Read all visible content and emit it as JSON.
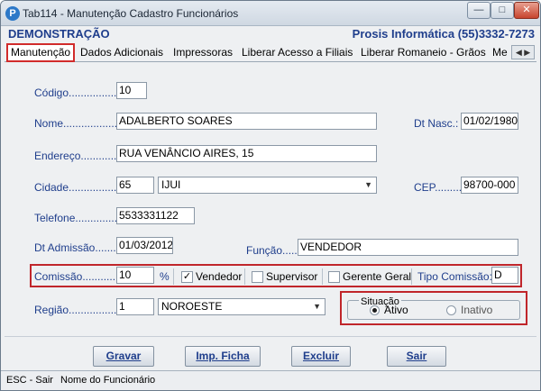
{
  "window": {
    "title": "Tab114 - Manutenção Cadastro Funcionários",
    "app_icon_letter": "P",
    "min_glyph": "—",
    "max_glyph": "□",
    "close_glyph": "✕"
  },
  "header": {
    "company": "DEMONSTRAÇÃO",
    "vendor": "Prosis Informática (55)3332-7273"
  },
  "tabs": [
    {
      "label": "Manutenção",
      "active": true
    },
    {
      "label": "Dados Adicionais"
    },
    {
      "label": "Impressoras"
    },
    {
      "label": "Liberar Acesso a Filiais"
    },
    {
      "label": "Liberar Romaneio - Grãos"
    },
    {
      "label": "Me"
    }
  ],
  "form": {
    "codigo": {
      "label": "Código.................",
      "value": "10"
    },
    "nome": {
      "label": "Nome.........................",
      "value": "ADALBERTO SOARES"
    },
    "dt_nasc": {
      "label": "Dt Nasc.:",
      "value": "01/02/1980"
    },
    "endereco": {
      "label": "Endereço......................",
      "value": "RUA VENÂNCIO AIRES, 15"
    },
    "cidade": {
      "label": "Cidade...........................",
      "code": "65",
      "name": "IJUI"
    },
    "cep": {
      "label": "CEP..........",
      "value": "98700-000"
    },
    "telefone": {
      "label": "Telefone.......................",
      "value": "5533331122"
    },
    "dt_admissao": {
      "label": "Dt Admissão...........",
      "value": "01/03/2012"
    },
    "funcao": {
      "label": "Função.....:",
      "value": "VENDEDOR"
    },
    "comissao": {
      "label": "Comissão...............",
      "value": "10",
      "unit": "%"
    },
    "vendedor": {
      "label": "Vendedor",
      "checked": true
    },
    "supervisor": {
      "label": "Supervisor",
      "checked": false
    },
    "gerente_geral": {
      "label": "Gerente Geral",
      "checked": false
    },
    "tipo_comissao": {
      "label": "Tipo Comissão:",
      "value": "D"
    },
    "regiao": {
      "label": "Região...................",
      "code": "1",
      "name": "NOROESTE"
    },
    "situacao": {
      "title": "Situação",
      "options": [
        {
          "label": "Ativo",
          "selected": true
        },
        {
          "label": "Inativo",
          "selected": false
        }
      ]
    }
  },
  "buttons": {
    "gravar": "Gravar",
    "imp_ficha": "Imp. Ficha",
    "excluir": "Excluir",
    "sair": "Sair"
  },
  "status": {
    "left": "ESC - Sair",
    "right": "Nome do Funcionário"
  },
  "colors": {
    "label_blue": "#1f3e8c",
    "highlight_red": "#c0262b"
  },
  "icons": {
    "app": "prosis-logo-icon",
    "tab_scroll": "tab-scroll-arrows-icon",
    "dropdown": "chevron-down-icon"
  }
}
